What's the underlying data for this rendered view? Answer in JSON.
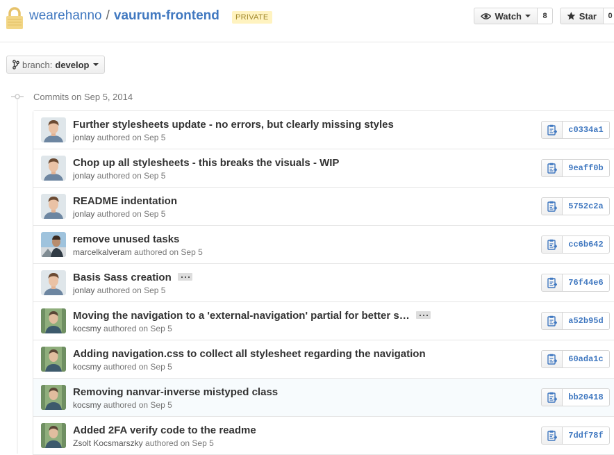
{
  "repo": {
    "owner": "wearehanno",
    "separator": "/",
    "name": "vaurum-frontend",
    "visibility": "PRIVATE"
  },
  "actions": {
    "watch_label": "Watch",
    "watch_count": "8",
    "star_label": "Star",
    "star_count": "0"
  },
  "branch": {
    "prefix": "branch:",
    "name": "develop"
  },
  "group_date": "Commits on Sep 5, 2014",
  "commits": [
    {
      "message": "Further stylesheets update - no errors, but clearly missing styles",
      "author": "jonlay",
      "authored": "authored on Sep 5",
      "sha": "c0334a1",
      "avatar": "person-a",
      "ellipsis": false
    },
    {
      "message": "Chop up all stylesheets - this breaks the visuals - WIP",
      "author": "jonlay",
      "authored": "authored on Sep 5",
      "sha": "9eaff0b",
      "avatar": "person-a",
      "ellipsis": false
    },
    {
      "message": "README indentation",
      "author": "jonlay",
      "authored": "authored on Sep 5",
      "sha": "5752c2a",
      "avatar": "person-a",
      "ellipsis": false
    },
    {
      "message": "remove unused tasks",
      "author": "marcelkalveram",
      "authored": "authored on Sep 5",
      "sha": "cc6b642",
      "avatar": "person-b",
      "ellipsis": false
    },
    {
      "message": "Basis Sass creation",
      "author": "jonlay",
      "authored": "authored on Sep 5",
      "sha": "76f44e6",
      "avatar": "person-a",
      "ellipsis": true
    },
    {
      "message": "Moving the navigation to a 'external-navigation' partial for better s…",
      "author": "kocsmy",
      "authored": "authored on Sep 5",
      "sha": "a52b95d",
      "avatar": "person-c",
      "ellipsis": true
    },
    {
      "message": "Adding navigation.css to collect all stylesheet regarding the navigation",
      "author": "kocsmy",
      "authored": "authored on Sep 5",
      "sha": "60ada1c",
      "avatar": "person-c",
      "ellipsis": false
    },
    {
      "message": "Removing nanvar-inverse mistyped class",
      "author": "kocsmy",
      "authored": "authored on Sep 5",
      "sha": "bb20418",
      "avatar": "person-c",
      "ellipsis": false
    },
    {
      "message": "Added 2FA verify code to the readme",
      "author": "Zsolt Kocsmarszky",
      "authored": "authored on Sep 5",
      "sha": "7ddf78f",
      "avatar": "person-c",
      "ellipsis": false
    }
  ],
  "highlighted_row": 7
}
